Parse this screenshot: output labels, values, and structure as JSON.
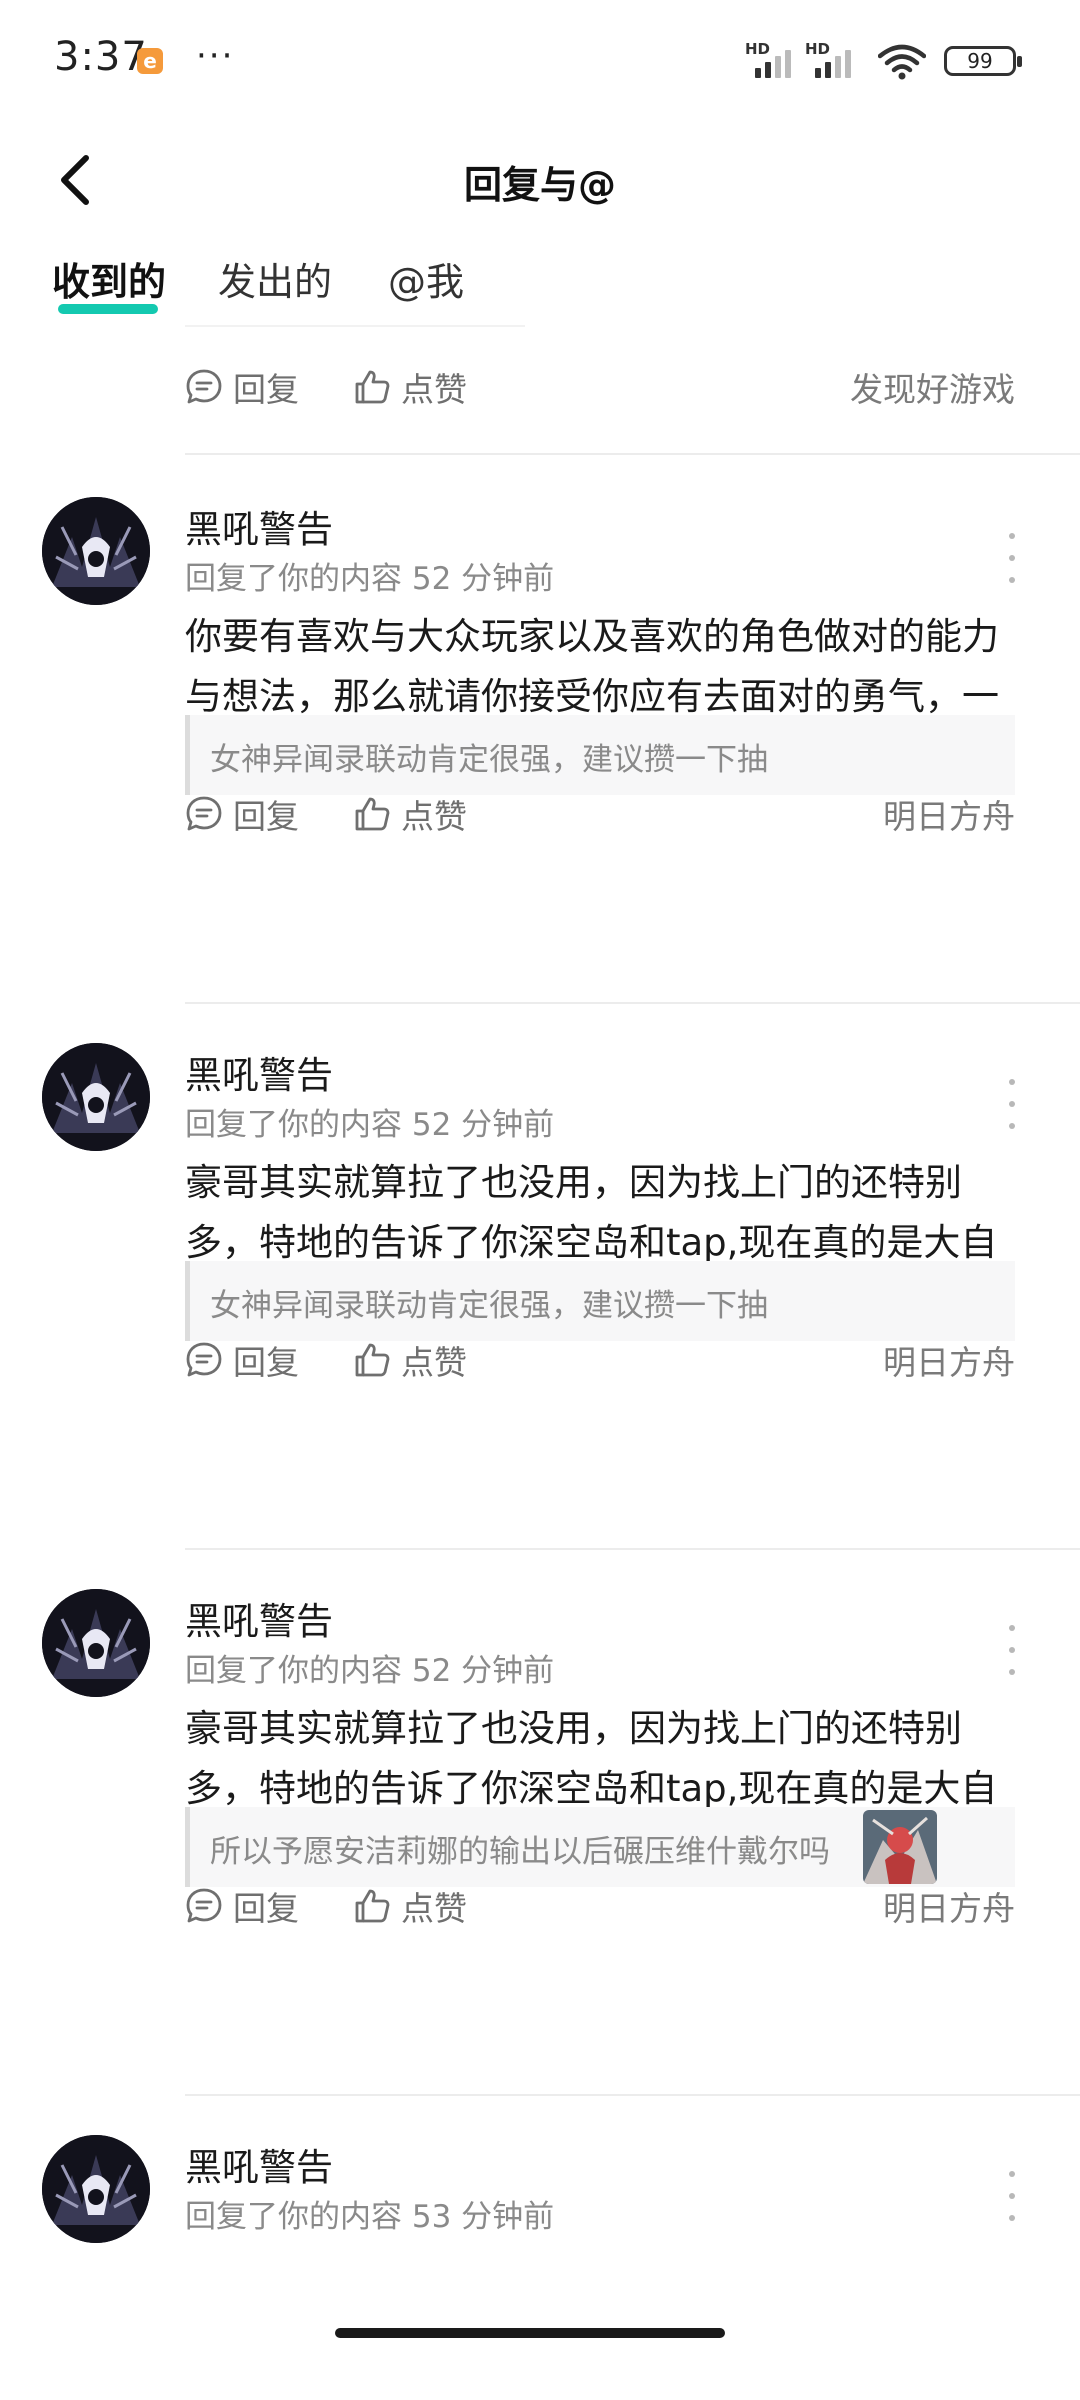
{
  "status_bar": {
    "time": "3:37",
    "app_badge": "e",
    "more_dots": "···",
    "signal_1_label": "HD",
    "signal_2_label": "HD",
    "battery": "99"
  },
  "nav": {
    "title": "回复与@"
  },
  "tabs": [
    {
      "label": "收到的",
      "active": true
    },
    {
      "label": "发出的",
      "active": false
    },
    {
      "label": "@我",
      "active": false
    }
  ],
  "top_partial_item": {
    "reply_label": "回复",
    "like_label": "点赞",
    "game": "发现好游戏"
  },
  "comments": [
    {
      "username": "黑吼警告",
      "meta": "回复了你的内容 52 分钟前",
      "text": "你要有喜欢与大众玩家以及喜欢的角色做对的能力与想法，那么就请你接受你应有去面对的勇气，一直逃避也不好，只会越陷越深",
      "quote": "女神异闻录联动肯定很强，建议攒一下抽",
      "quote_has_image": false,
      "reply_label": "回复",
      "like_label": "点赞",
      "game": "明日方舟"
    },
    {
      "username": "黑吼警告",
      "meta": "回复了你的内容 52 分钟前",
      "text": "豪哥其实就算拉了也没用，因为找上门的还特别多，特地的告诉了你深空岛和tap,现在真的是大自由的时候好好期待吧",
      "quote": "女神异闻录联动肯定很强，建议攒一下抽",
      "quote_has_image": false,
      "reply_label": "回复",
      "like_label": "点赞",
      "game": "明日方舟"
    },
    {
      "username": "黑吼警告",
      "meta": "回复了你的内容 52 分钟前",
      "text": "豪哥其实就算拉了也没用，因为找上门的还特别多，特地的告诉了你深空岛和tap,现在真的是大自由的时候好好期待吧",
      "quote": "所以予愿安洁莉娜的输出以后碾压维什戴尔吗",
      "quote_has_image": true,
      "reply_label": "回复",
      "like_label": "点赞",
      "game": "明日方舟"
    },
    {
      "username": "黑吼警告",
      "meta": "回复了你的内容 53 分钟前"
    }
  ],
  "colors": {
    "tab_accent": "#14c9b0",
    "secondary_text": "#8a8a8a",
    "primary_text": "#1a1a1a",
    "divider": "#ececec"
  },
  "icons": {
    "back": "chevron-left-icon",
    "reply": "comment-bubble-icon",
    "like": "thumbs-up-icon",
    "more": "vertical-dots-icon"
  }
}
